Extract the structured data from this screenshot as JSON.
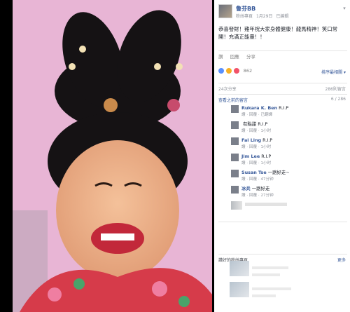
{
  "post": {
    "author": "鲁芬BB",
    "meta_items": [
      "粉絲專頁",
      "1月29日",
      "已編輯"
    ],
    "text": "恭喜發財！雞年祝大家身體健康！龍馬精神！笑口常開！充滿正能量！！",
    "actions": [
      "讚",
      "回應",
      "分享"
    ],
    "reaction_count": "862",
    "sort_label": "排序最相關 ▾",
    "shares_label": "24次分享",
    "shares_right": "286則留言",
    "prev_comments_label": "查看之前的留言",
    "prev_comments_count": "6 / 286"
  },
  "comments": [
    {
      "name": "Rukara K. Ben",
      "body": "R.I.P",
      "meta": "讚 · 回覆 · 已翻譯"
    },
    {
      "name": "",
      "body": "有點甜 R.I.P",
      "meta": "讚 · 回覆 · 1小时"
    },
    {
      "name": "Fai Ling",
      "body": "R.I.P",
      "meta": "讚 · 回覆 · 1小时"
    },
    {
      "name": "Jim Lee",
      "body": "R.I.P",
      "meta": "讚 · 回覆 · 1小时"
    },
    {
      "name": "Susan Tse",
      "body": "一路好走~",
      "meta": "讚 · 回覆 · 47分钟"
    },
    {
      "name": "冰兵",
      "body": "一路好走",
      "meta": "讚 · 回覆 · 27分钟"
    }
  ],
  "tagged": {
    "label": "讚好的粉絲專頁",
    "right": "更多"
  },
  "colors": {
    "link": "#365899",
    "muted": "#90949c",
    "photo_bg": "#e9b7d6"
  }
}
